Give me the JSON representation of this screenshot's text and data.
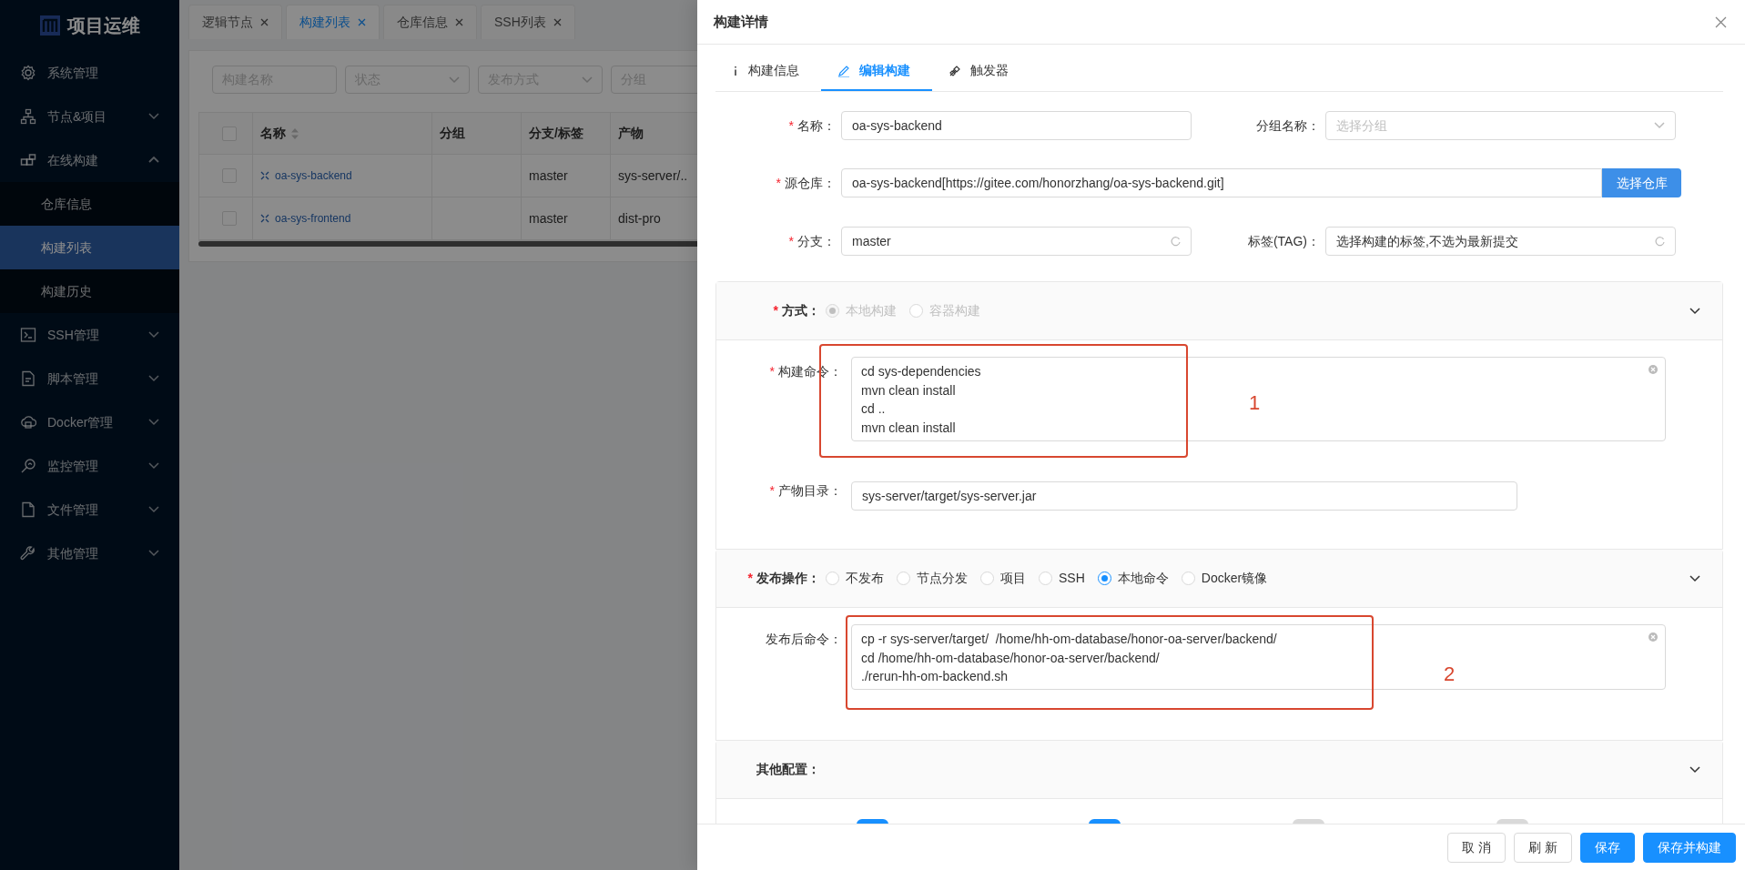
{
  "sidebar": {
    "logo": "项目运维",
    "items": [
      {
        "label": "系统管理"
      },
      {
        "label": "节点&项目",
        "expanded": false
      },
      {
        "label": "在线构建",
        "expanded": true,
        "children": [
          {
            "label": "仓库信息",
            "selected": false
          },
          {
            "label": "构建列表",
            "selected": true
          },
          {
            "label": "构建历史",
            "selected": false
          }
        ]
      },
      {
        "label": "SSH管理",
        "expanded": false
      },
      {
        "label": "脚本管理",
        "expanded": false
      },
      {
        "label": "Docker管理",
        "expanded": false
      },
      {
        "label": "监控管理",
        "expanded": false
      },
      {
        "label": "文件管理",
        "expanded": false
      },
      {
        "label": "其他管理",
        "expanded": false
      }
    ]
  },
  "page_tabs": [
    {
      "label": "逻辑节点",
      "selected": false
    },
    {
      "label": "构建列表",
      "selected": true
    },
    {
      "label": "仓库信息",
      "selected": false
    },
    {
      "label": "SSH列表",
      "selected": false
    }
  ],
  "filters": [
    {
      "kind": "input",
      "placeholder": "构建名称"
    },
    {
      "kind": "select",
      "placeholder": "状态"
    },
    {
      "kind": "select",
      "placeholder": "发布方式"
    },
    {
      "kind": "input",
      "placeholder": "分组"
    }
  ],
  "table": {
    "all_checked": false,
    "columns": [
      {
        "label": "名称",
        "sortable": true
      },
      {
        "label": "分组",
        "sortable": false
      },
      {
        "label": "分支/标签",
        "sortable": false
      },
      {
        "label": "产物",
        "sortable": false
      }
    ],
    "rows": [
      {
        "checked": false,
        "name": "oa-sys-backend",
        "branch": "master",
        "product": "sys-server/.."
      },
      {
        "checked": false,
        "name": "oa-sys-frontend",
        "branch": "master",
        "product": "dist-pro"
      }
    ]
  },
  "drawer": {
    "title": "构建详情",
    "tabs": [
      {
        "label": "构建信息",
        "selected": false
      },
      {
        "label": "编辑构建",
        "selected": true
      },
      {
        "label": "触发器",
        "selected": false
      }
    ],
    "name": {
      "mark": "*",
      "label": "名称：",
      "value": "oa-sys-backend"
    },
    "group": {
      "label": "分组名称：",
      "placeholder": "选择分组"
    },
    "repo": {
      "mark": "*",
      "label": "源仓库：",
      "value": "oa-sys-backend[https://gitee.com/honorzhang/oa-sys-backend.git]",
      "button": "选择仓库"
    },
    "branch": {
      "mark": "*",
      "label": "分支：",
      "value": "master"
    },
    "tag": {
      "label": "标签(TAG)：",
      "value": "选择构建的标签,不选为最新提交"
    },
    "sections": [
      {
        "mark": "*",
        "label": "方式：",
        "disabled": true,
        "options": [
          {
            "label": "本地构建",
            "selected": true
          },
          {
            "label": "容器构建",
            "selected": false
          }
        ],
        "fields": [
          {
            "kind": "textarea",
            "mark": "*",
            "label": "构建命令：",
            "value": "cd sys-dependencies\nmvn clean install\ncd ..\nmvn clean install",
            "annotation": "1"
          },
          {
            "kind": "input",
            "mark": "*",
            "label": "产物目录：",
            "value": "sys-server/target/sys-server.jar"
          }
        ]
      },
      {
        "mark": "*",
        "label": "发布操作：",
        "disabled": false,
        "options": [
          {
            "label": "不发布",
            "selected": false
          },
          {
            "label": "节点分发",
            "selected": false
          },
          {
            "label": "项目",
            "selected": false
          },
          {
            "label": "SSH",
            "selected": false
          },
          {
            "label": "本地命令",
            "selected": true
          },
          {
            "label": "Docker镜像",
            "selected": false
          }
        ],
        "fields": [
          {
            "kind": "textarea",
            "label": "发布后命令：",
            "value": "cp -r sys-server/target/  /home/hh-om-database/honor-oa-server/backend/\ncd /home/hh-om-database/honor-oa-server/backend/\n./rerun-hh-om-backend.sh",
            "annotation": "2"
          }
        ]
      },
      {
        "label": "其他配置：",
        "switches": [
          {
            "on": true
          },
          {
            "on": true
          },
          {
            "on": false
          },
          {
            "on": false
          }
        ]
      }
    ],
    "buttons": [
      {
        "label": "取 消",
        "kind": "default"
      },
      {
        "label": "刷 新",
        "kind": "default"
      },
      {
        "label": "保存",
        "kind": "primary"
      },
      {
        "label": "保存并构建",
        "kind": "primary"
      }
    ]
  }
}
